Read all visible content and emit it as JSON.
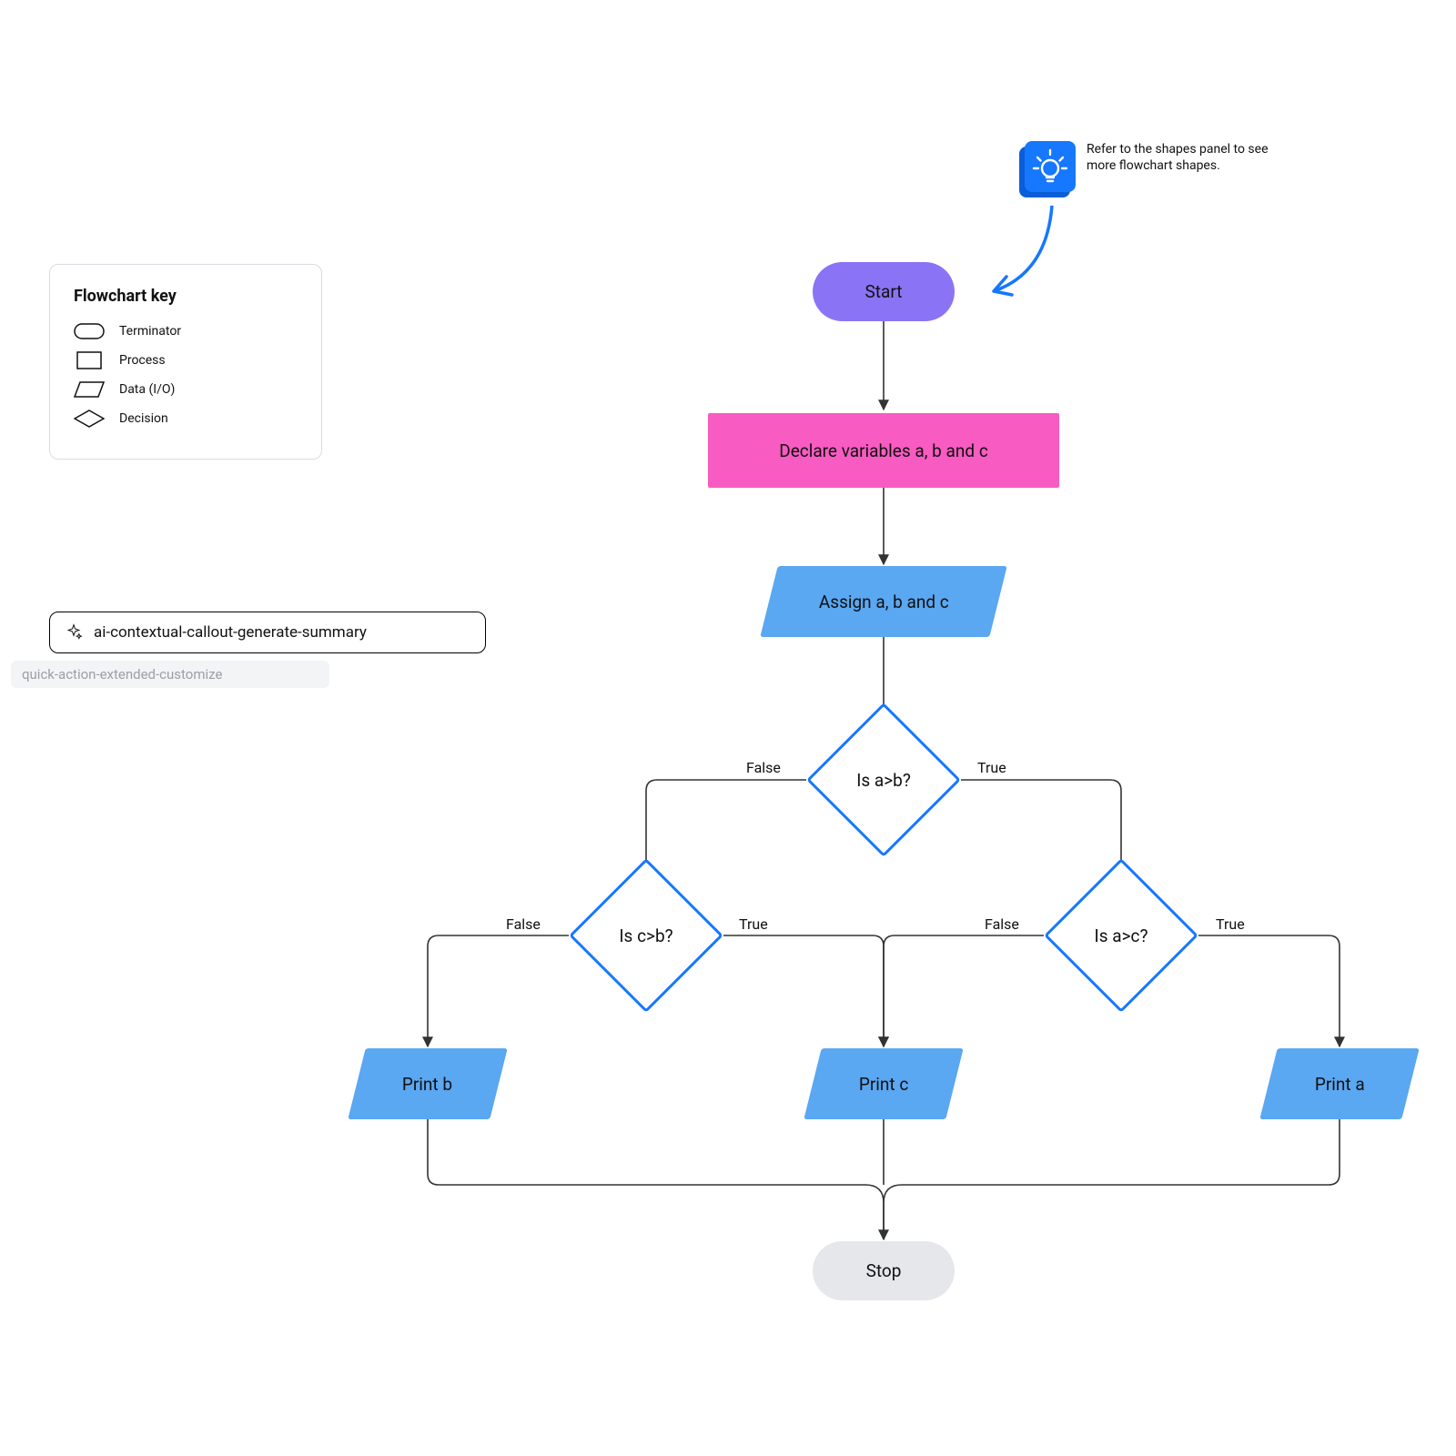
{
  "key": {
    "title": "Flowchart key",
    "items": [
      {
        "label": "Terminator",
        "shape": "terminator"
      },
      {
        "label": "Process",
        "shape": "process"
      },
      {
        "label": "Data (I/O)",
        "shape": "data"
      },
      {
        "label": "Decision",
        "shape": "decision"
      }
    ]
  },
  "ai_chip": {
    "label": "ai-contextual-callout-generate-summary"
  },
  "quick_action": {
    "label": "quick-action-extended-customize"
  },
  "tip": {
    "text": "Refer to the shapes panel to see more flowchart shapes."
  },
  "colors": {
    "purple": "#8a74f5",
    "pink": "#f85bc1",
    "blue": "#5aa7f2",
    "blueStroke": "#1677ff",
    "grey": "#e6e7eb",
    "arrow": "#333333"
  },
  "nodes": {
    "start": {
      "label": "Start"
    },
    "declare": {
      "label": "Declare variables a, b and c"
    },
    "assign": {
      "label": "Assign a, b and c"
    },
    "decAB": {
      "label": "Is a>b?"
    },
    "decCB": {
      "label": "Is c>b?"
    },
    "decAC": {
      "label": "Is a>c?"
    },
    "printB": {
      "label": "Print b"
    },
    "printC": {
      "label": "Print c"
    },
    "printA": {
      "label": "Print a"
    },
    "stop": {
      "label": "Stop"
    }
  },
  "edges": {
    "true": "True",
    "false": "False"
  }
}
